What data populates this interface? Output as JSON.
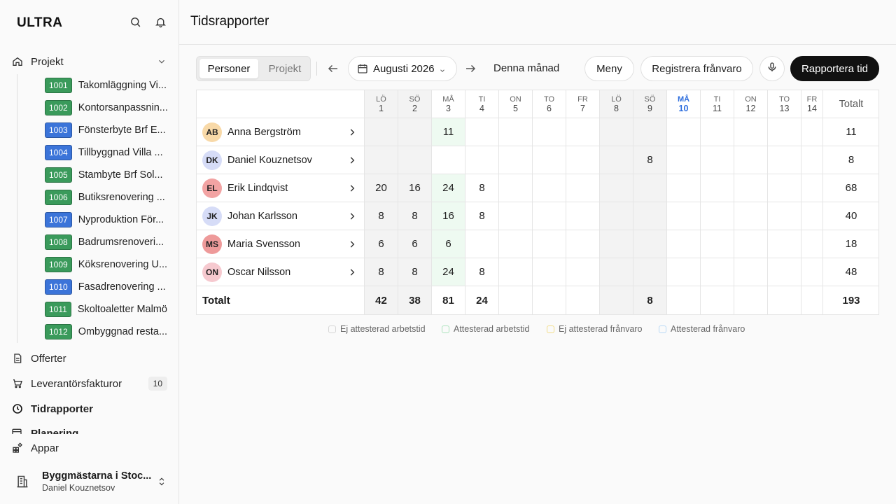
{
  "app": {
    "logo": "ULTRA"
  },
  "sidebar": {
    "projects_label": "Projekt",
    "projects": [
      {
        "id": "1001",
        "name": "Takomläggning Vi...",
        "color": "#3a9a5b"
      },
      {
        "id": "1002",
        "name": "Kontorsanpassnin...",
        "color": "#3a9a5b"
      },
      {
        "id": "1003",
        "name": "Fönsterbyte Brf E...",
        "color": "#3b74d9"
      },
      {
        "id": "1004",
        "name": "Tillbyggnad Villa ...",
        "color": "#3b74d9"
      },
      {
        "id": "1005",
        "name": "Stambyte Brf Sol...",
        "color": "#3a9a5b"
      },
      {
        "id": "1006",
        "name": "Butiksrenovering ...",
        "color": "#3a9a5b"
      },
      {
        "id": "1007",
        "name": "Nyproduktion För...",
        "color": "#3b74d9"
      },
      {
        "id": "1008",
        "name": "Badrumsrenoveri...",
        "color": "#3a9a5b"
      },
      {
        "id": "1009",
        "name": "Köksrenovering U...",
        "color": "#3a9a5b"
      },
      {
        "id": "1010",
        "name": "Fasadrenovering ...",
        "color": "#3b74d9"
      },
      {
        "id": "1011",
        "name": "Skoltoaletter Malmö",
        "color": "#3a9a5b"
      },
      {
        "id": "1012",
        "name": "Ombyggnad resta...",
        "color": "#3a9a5b"
      }
    ],
    "offers_label": "Offerter",
    "invoices_label": "Leverantörsfakturor",
    "invoices_count": "10",
    "timereports_label": "Tidrapporter",
    "cut_label": "Planering",
    "apps_label": "Appar",
    "org_name": "Byggmästarna i Stoc...",
    "org_user": "Daniel Kouznetsov"
  },
  "header": {
    "title": "Tidsrapporter"
  },
  "toolbar": {
    "seg_persons": "Personer",
    "seg_projects": "Projekt",
    "date": "Augusti 2026",
    "this_month": "Denna månad",
    "menu": "Meny",
    "register_absence": "Registrera frånvaro",
    "report_time": "Rapportera tid"
  },
  "table": {
    "days": [
      {
        "name": "LÖ",
        "num": "1",
        "weekend": true
      },
      {
        "name": "SÖ",
        "num": "2",
        "weekend": true
      },
      {
        "name": "MÅ",
        "num": "3",
        "weekend": false
      },
      {
        "name": "TI",
        "num": "4",
        "weekend": false
      },
      {
        "name": "ON",
        "num": "5",
        "weekend": false
      },
      {
        "name": "TO",
        "num": "6",
        "weekend": false
      },
      {
        "name": "FR",
        "num": "7",
        "weekend": false
      },
      {
        "name": "LÖ",
        "num": "8",
        "weekend": true
      },
      {
        "name": "SÖ",
        "num": "9",
        "weekend": true
      },
      {
        "name": "MÅ",
        "num": "10",
        "weekend": false,
        "today": true
      },
      {
        "name": "TI",
        "num": "11",
        "weekend": false
      },
      {
        "name": "ON",
        "num": "12",
        "weekend": false
      },
      {
        "name": "TO",
        "num": "13",
        "weekend": false
      },
      {
        "name": "FR",
        "num": "14",
        "weekend": false
      }
    ],
    "total_header": "Totalt",
    "people": [
      {
        "initials": "AB",
        "name": "Anna Bergström",
        "avatar_color": "#f8d9a8",
        "hours": [
          "",
          "",
          "11",
          "",
          "",
          "",
          "",
          "",
          "",
          "",
          "",
          "",
          "",
          ""
        ],
        "total": "11"
      },
      {
        "initials": "DK",
        "name": "Daniel Kouznetsov",
        "avatar_color": "#d6dcf7",
        "hours": [
          "",
          "",
          "",
          "",
          "",
          "",
          "",
          "",
          "8",
          "",
          "",
          "",
          "",
          ""
        ],
        "total": "8"
      },
      {
        "initials": "EL",
        "name": "Erik Lindqvist",
        "avatar_color": "#f2a3a3",
        "hours": [
          "20",
          "16",
          "24",
          "8",
          "",
          "",
          "",
          "",
          "",
          "",
          "",
          "",
          "",
          ""
        ],
        "total": "68"
      },
      {
        "initials": "JK",
        "name": "Johan Karlsson",
        "avatar_color": "#d6dcf7",
        "hours": [
          "8",
          "8",
          "16",
          "8",
          "",
          "",
          "",
          "",
          "",
          "",
          "",
          "",
          "",
          ""
        ],
        "total": "40"
      },
      {
        "initials": "MS",
        "name": "Maria Svensson",
        "avatar_color": "#ee9a9a",
        "hours": [
          "6",
          "6",
          "6",
          "",
          "",
          "",
          "",
          "",
          "",
          "",
          "",
          "",
          "",
          ""
        ],
        "total": "18"
      },
      {
        "initials": "ON",
        "name": "Oscar Nilsson",
        "avatar_color": "#f6c9cf",
        "hours": [
          "8",
          "8",
          "24",
          "8",
          "",
          "",
          "",
          "",
          "",
          "",
          "",
          "",
          "",
          ""
        ],
        "total": "48"
      }
    ],
    "total_label": "Totalt",
    "day_totals": [
      "42",
      "38",
      "81",
      "24",
      "",
      "",
      "",
      "",
      "8",
      "",
      "",
      "",
      "",
      ""
    ],
    "grand_total": "193"
  },
  "legend": [
    {
      "label": "Ej attesterad arbetstid",
      "color": "#d6d6d6"
    },
    {
      "label": "Attesterad arbetstid",
      "color": "#a9e2bb"
    },
    {
      "label": "Ej attesterad frånvaro",
      "color": "#f2dc86"
    },
    {
      "label": "Attesterad frånvaro",
      "color": "#b8d8f5"
    }
  ]
}
